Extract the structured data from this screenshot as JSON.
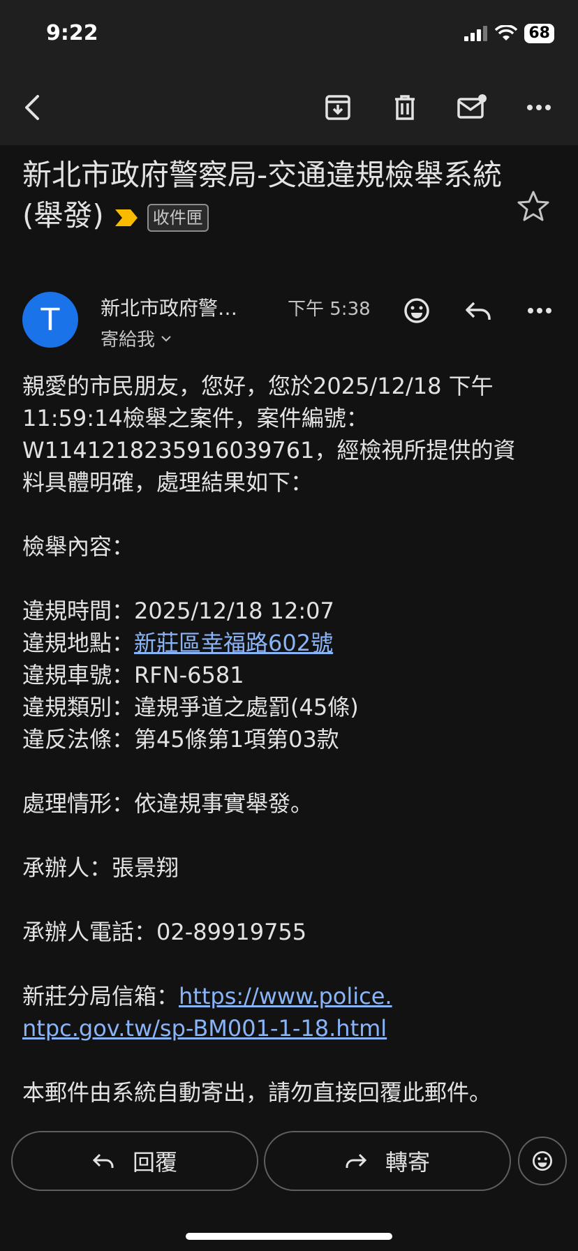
{
  "status_bar": {
    "time": "9:22",
    "battery": "68"
  },
  "email": {
    "subject": "新北市政府警察局-交通違規檢舉系統(舉發)",
    "label": "收件匣",
    "sender_initial": "T",
    "sender_name": "新北市政府警…",
    "time": "下午 5:38",
    "recipient": "寄給我",
    "body": {
      "intro_line1": "親愛的市民朋友，您好，您於2025/12/18 下午",
      "intro_line2": "11:59:14檢舉之案件，案件編號：",
      "intro_line3": "W1141218235916039761，經檢視所提供的資",
      "intro_line4": "料具體明確，處理結果如下：",
      "content_heading": "檢舉內容：",
      "violation_time": "違規時間：2025/12/18 12:07",
      "location_label": "違規地點：",
      "location_link": "新莊區幸福路602號",
      "plate": "違規車號：RFN-6581",
      "category": "違規類別：違規爭道之處罰(45條)",
      "law": "違反法條：第45條第1項第03款",
      "handling": "處理情形：依違規事實舉發。",
      "officer": "承辦人：張景翔",
      "officer_phone": "承辦人電話：02-89919755",
      "mailbox_label": "新莊分局信箱：",
      "mailbox_link_line1": "https://www.police.",
      "mailbox_link_line2": "ntpc.gov.tw/sp-BM001-1-18.html",
      "footer": "本郵件由系統自動寄出，請勿直接回覆此郵件。"
    }
  },
  "actions": {
    "reply": "回覆",
    "forward": "轉寄"
  },
  "colors": {
    "avatar": "#1a73e8",
    "link": "#8ab4f8",
    "important": "#f9bb00"
  }
}
